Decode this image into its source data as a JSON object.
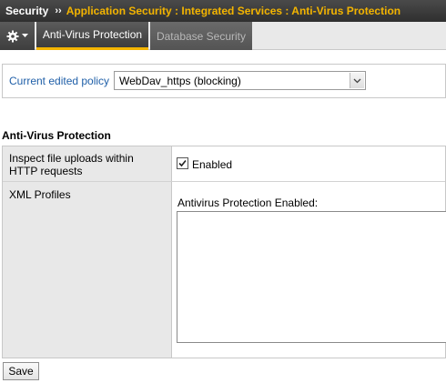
{
  "header": {
    "section": "Security",
    "separator": "››",
    "path": "Application Security : Integrated Services : Anti-Virus Protection"
  },
  "tabs": [
    {
      "label": "Anti-Virus Protection",
      "active": true
    },
    {
      "label": "Database Security",
      "active": false
    }
  ],
  "gear_menu": {
    "icon": "gear-icon",
    "dropdown_icon": "chevron-down-icon"
  },
  "policy": {
    "label": "Current edited policy",
    "selected": "WebDav_https (blocking)"
  },
  "section": {
    "title": "Anti-Virus Protection",
    "rows": [
      {
        "label": "Inspect file uploads within HTTP requests",
        "checkbox_label": "Enabled",
        "checked": true
      },
      {
        "label": "XML Profiles",
        "list_label": "Antivirus Protection Enabled:",
        "list_items": []
      }
    ]
  },
  "actions": {
    "save_label": "Save"
  },
  "colors": {
    "accent": "#f3b400",
    "link": "#1f5fa8",
    "header_bg": "#3a3a3a"
  }
}
